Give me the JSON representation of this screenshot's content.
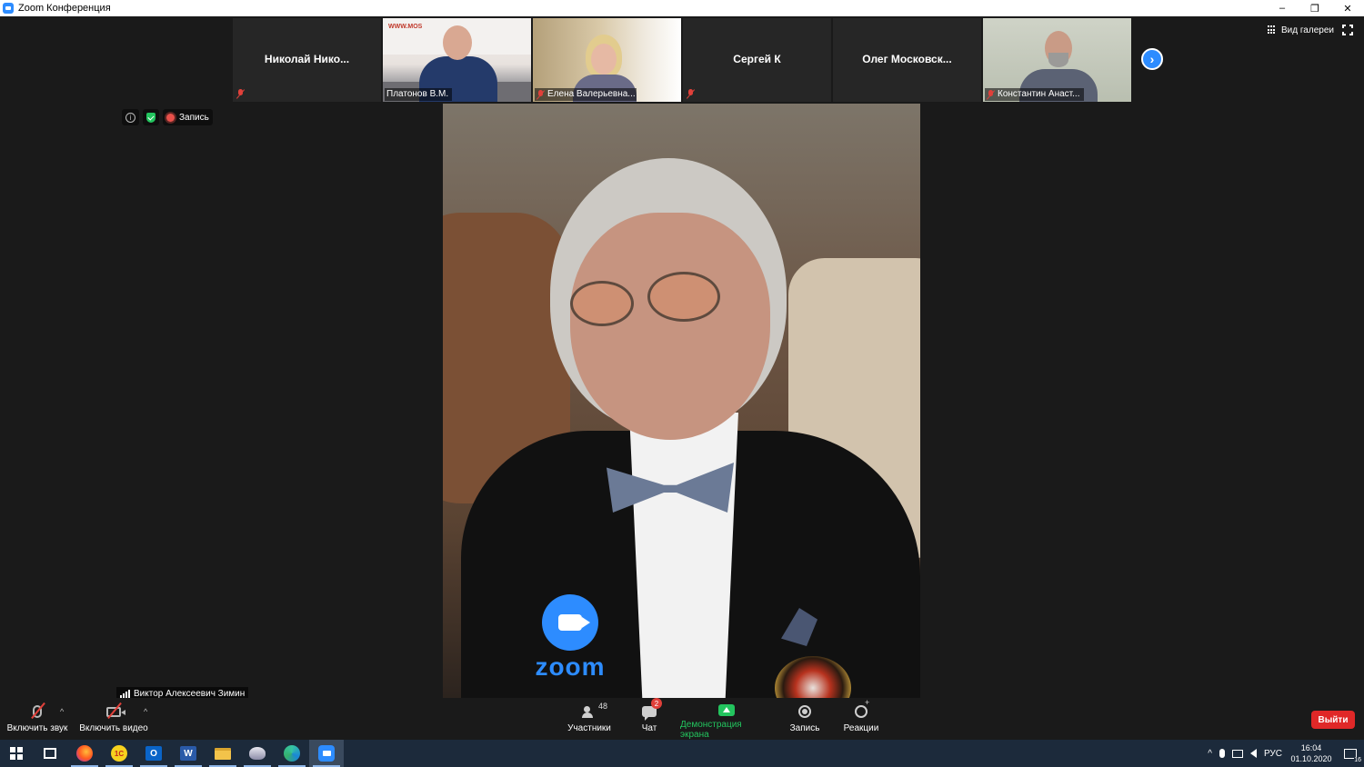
{
  "window": {
    "title": "Zoom Конференция",
    "controls": [
      "–",
      "❐",
      "✕"
    ]
  },
  "thumbnails": [
    {
      "type": "name",
      "name": "Николай  Нико...",
      "muted": true
    },
    {
      "type": "video",
      "label": "Платонов В.М.",
      "muted": false,
      "video_style": "plat",
      "wall_text": "WWW.MOS"
    },
    {
      "type": "video",
      "label": "Елена Валерьевна...",
      "muted": true,
      "video_style": "elena"
    },
    {
      "type": "name",
      "name": "Сергей К",
      "muted": true
    },
    {
      "type": "name",
      "name": "Олег  Московск...",
      "muted": false
    },
    {
      "type": "video",
      "label": "Константин Анаст...",
      "muted": true,
      "video_style": "konst"
    }
  ],
  "gallery_view": {
    "label": "Вид галереи"
  },
  "next_page": {
    "glyph": "›"
  },
  "info_bar": {
    "info_glyph": "i",
    "recording_label": "Запись"
  },
  "main_speaker": {
    "name": "Виктор Алексеевич Зимин",
    "logo_text": "zoom"
  },
  "toolbar": {
    "mute": {
      "label": "Включить звук"
    },
    "video": {
      "label": "Включить видео"
    },
    "participants": {
      "label": "Участники",
      "count": "48"
    },
    "chat": {
      "label": "Чат",
      "badge": "2"
    },
    "share": {
      "label": "Демонстрация экрана"
    },
    "record": {
      "label": "Запись"
    },
    "reactions": {
      "label": "Реакции"
    },
    "leave": {
      "label": "Выйти"
    },
    "caret_glyph": "^"
  },
  "taskbar": {
    "apps": [
      {
        "name": "task-view",
        "open": false
      },
      {
        "name": "firefox",
        "open": true
      },
      {
        "name": "1c",
        "open": true,
        "text": "1С"
      },
      {
        "name": "outlook",
        "open": true,
        "text": "O"
      },
      {
        "name": "word",
        "open": true,
        "text": "W"
      },
      {
        "name": "file-explorer",
        "open": true
      },
      {
        "name": "snipping",
        "open": true
      },
      {
        "name": "edge",
        "open": true
      },
      {
        "name": "zoom",
        "open": true,
        "active": true
      }
    ],
    "tray": {
      "chevron": "^",
      "language": "РУС",
      "time": "16:04",
      "date": "01.10.2020",
      "notifications": "16"
    }
  },
  "colors": {
    "accent": "#2d8cff",
    "share_green": "#23c45e",
    "leave_red": "#e02828",
    "muted_red": "#e0403a",
    "background": "#1a1a1a",
    "taskbar": "#1c2a3b"
  }
}
